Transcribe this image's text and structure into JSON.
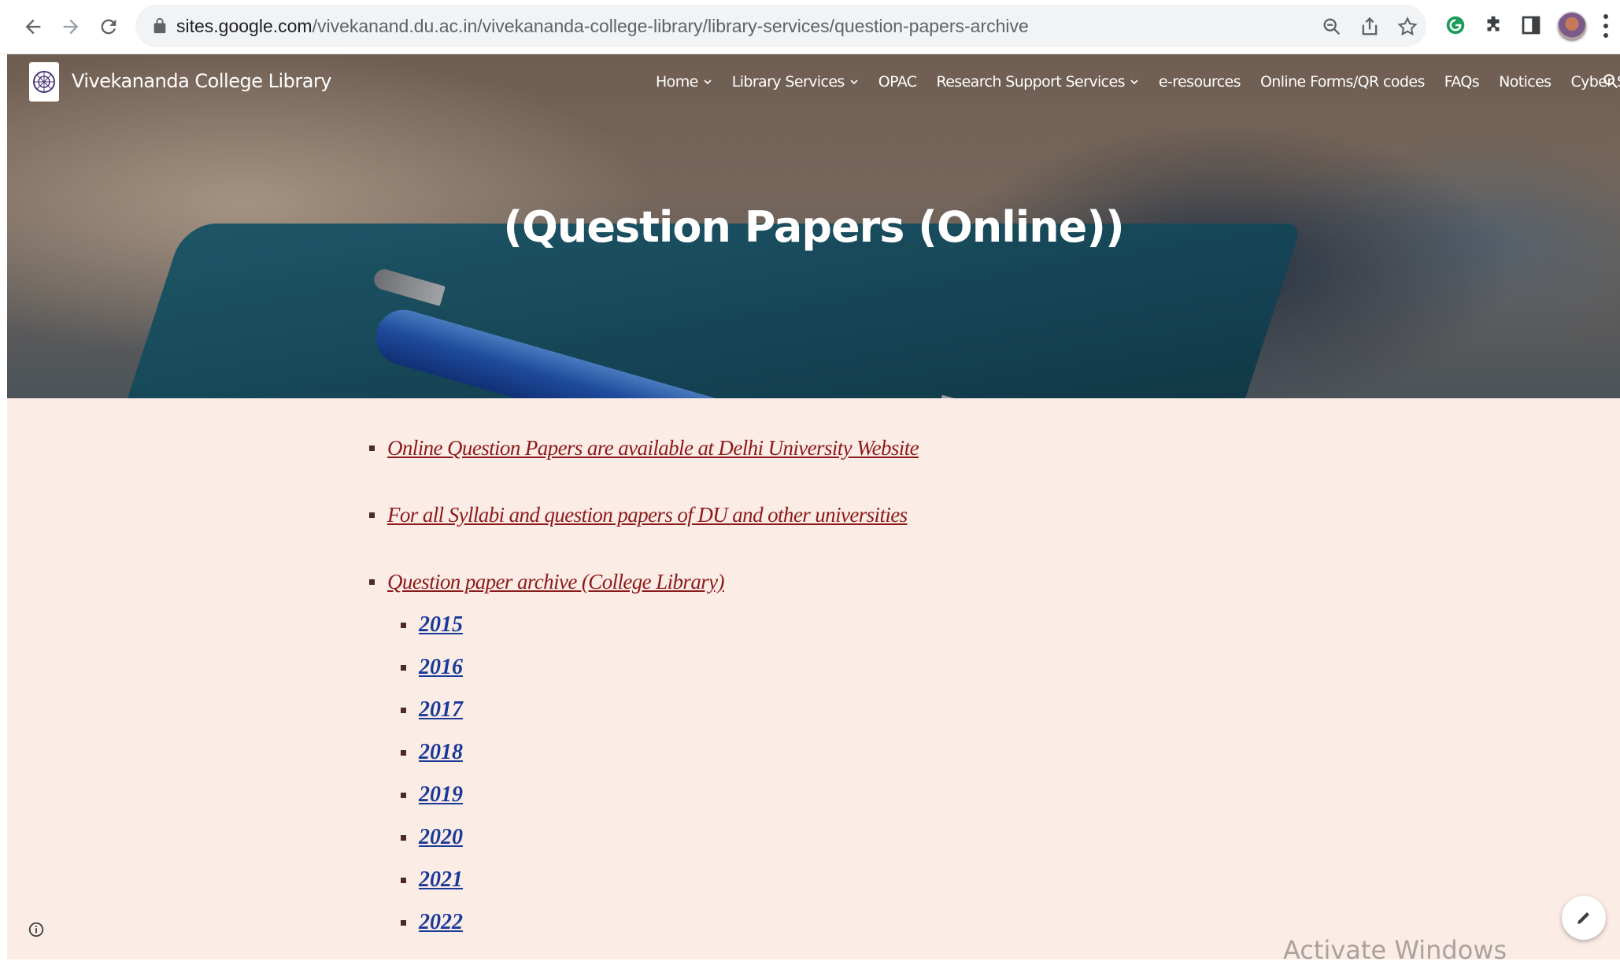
{
  "browser": {
    "url_host": "sites.google.com",
    "url_path": "/vivekanand.du.ac.in/vivekananda-college-library/library-services/question-papers-archive"
  },
  "site": {
    "name": "Vivekananda College Library",
    "nav": [
      {
        "label": "Home",
        "has_dropdown": true
      },
      {
        "label": "Library Services",
        "has_dropdown": true
      },
      {
        "label": "OPAC",
        "has_dropdown": false
      },
      {
        "label": "Research Support Services",
        "has_dropdown": true
      },
      {
        "label": "e-resources",
        "has_dropdown": false
      },
      {
        "label": "Online Forms/QR codes",
        "has_dropdown": false
      },
      {
        "label": "FAQs",
        "has_dropdown": false
      },
      {
        "label": "Notices",
        "has_dropdown": false
      },
      {
        "label": "Cyber Security",
        "has_dropdown": false
      }
    ]
  },
  "hero": {
    "title": "(Question Papers (Online))"
  },
  "content": {
    "links": [
      "Online Question Papers are available at Delhi University Website",
      "For all Syllabi and question papers of DU and other universities",
      "Question paper archive (College Library)"
    ],
    "years": [
      "2015",
      "2016",
      "2017",
      "2018",
      "2019",
      "2020",
      "2021",
      "2022"
    ]
  },
  "overlay": {
    "watermark": "Activate Windows"
  },
  "colors": {
    "link": "#8b1a1a",
    "year_link": "#1a3a9a",
    "content_bg": "#fcece6"
  }
}
